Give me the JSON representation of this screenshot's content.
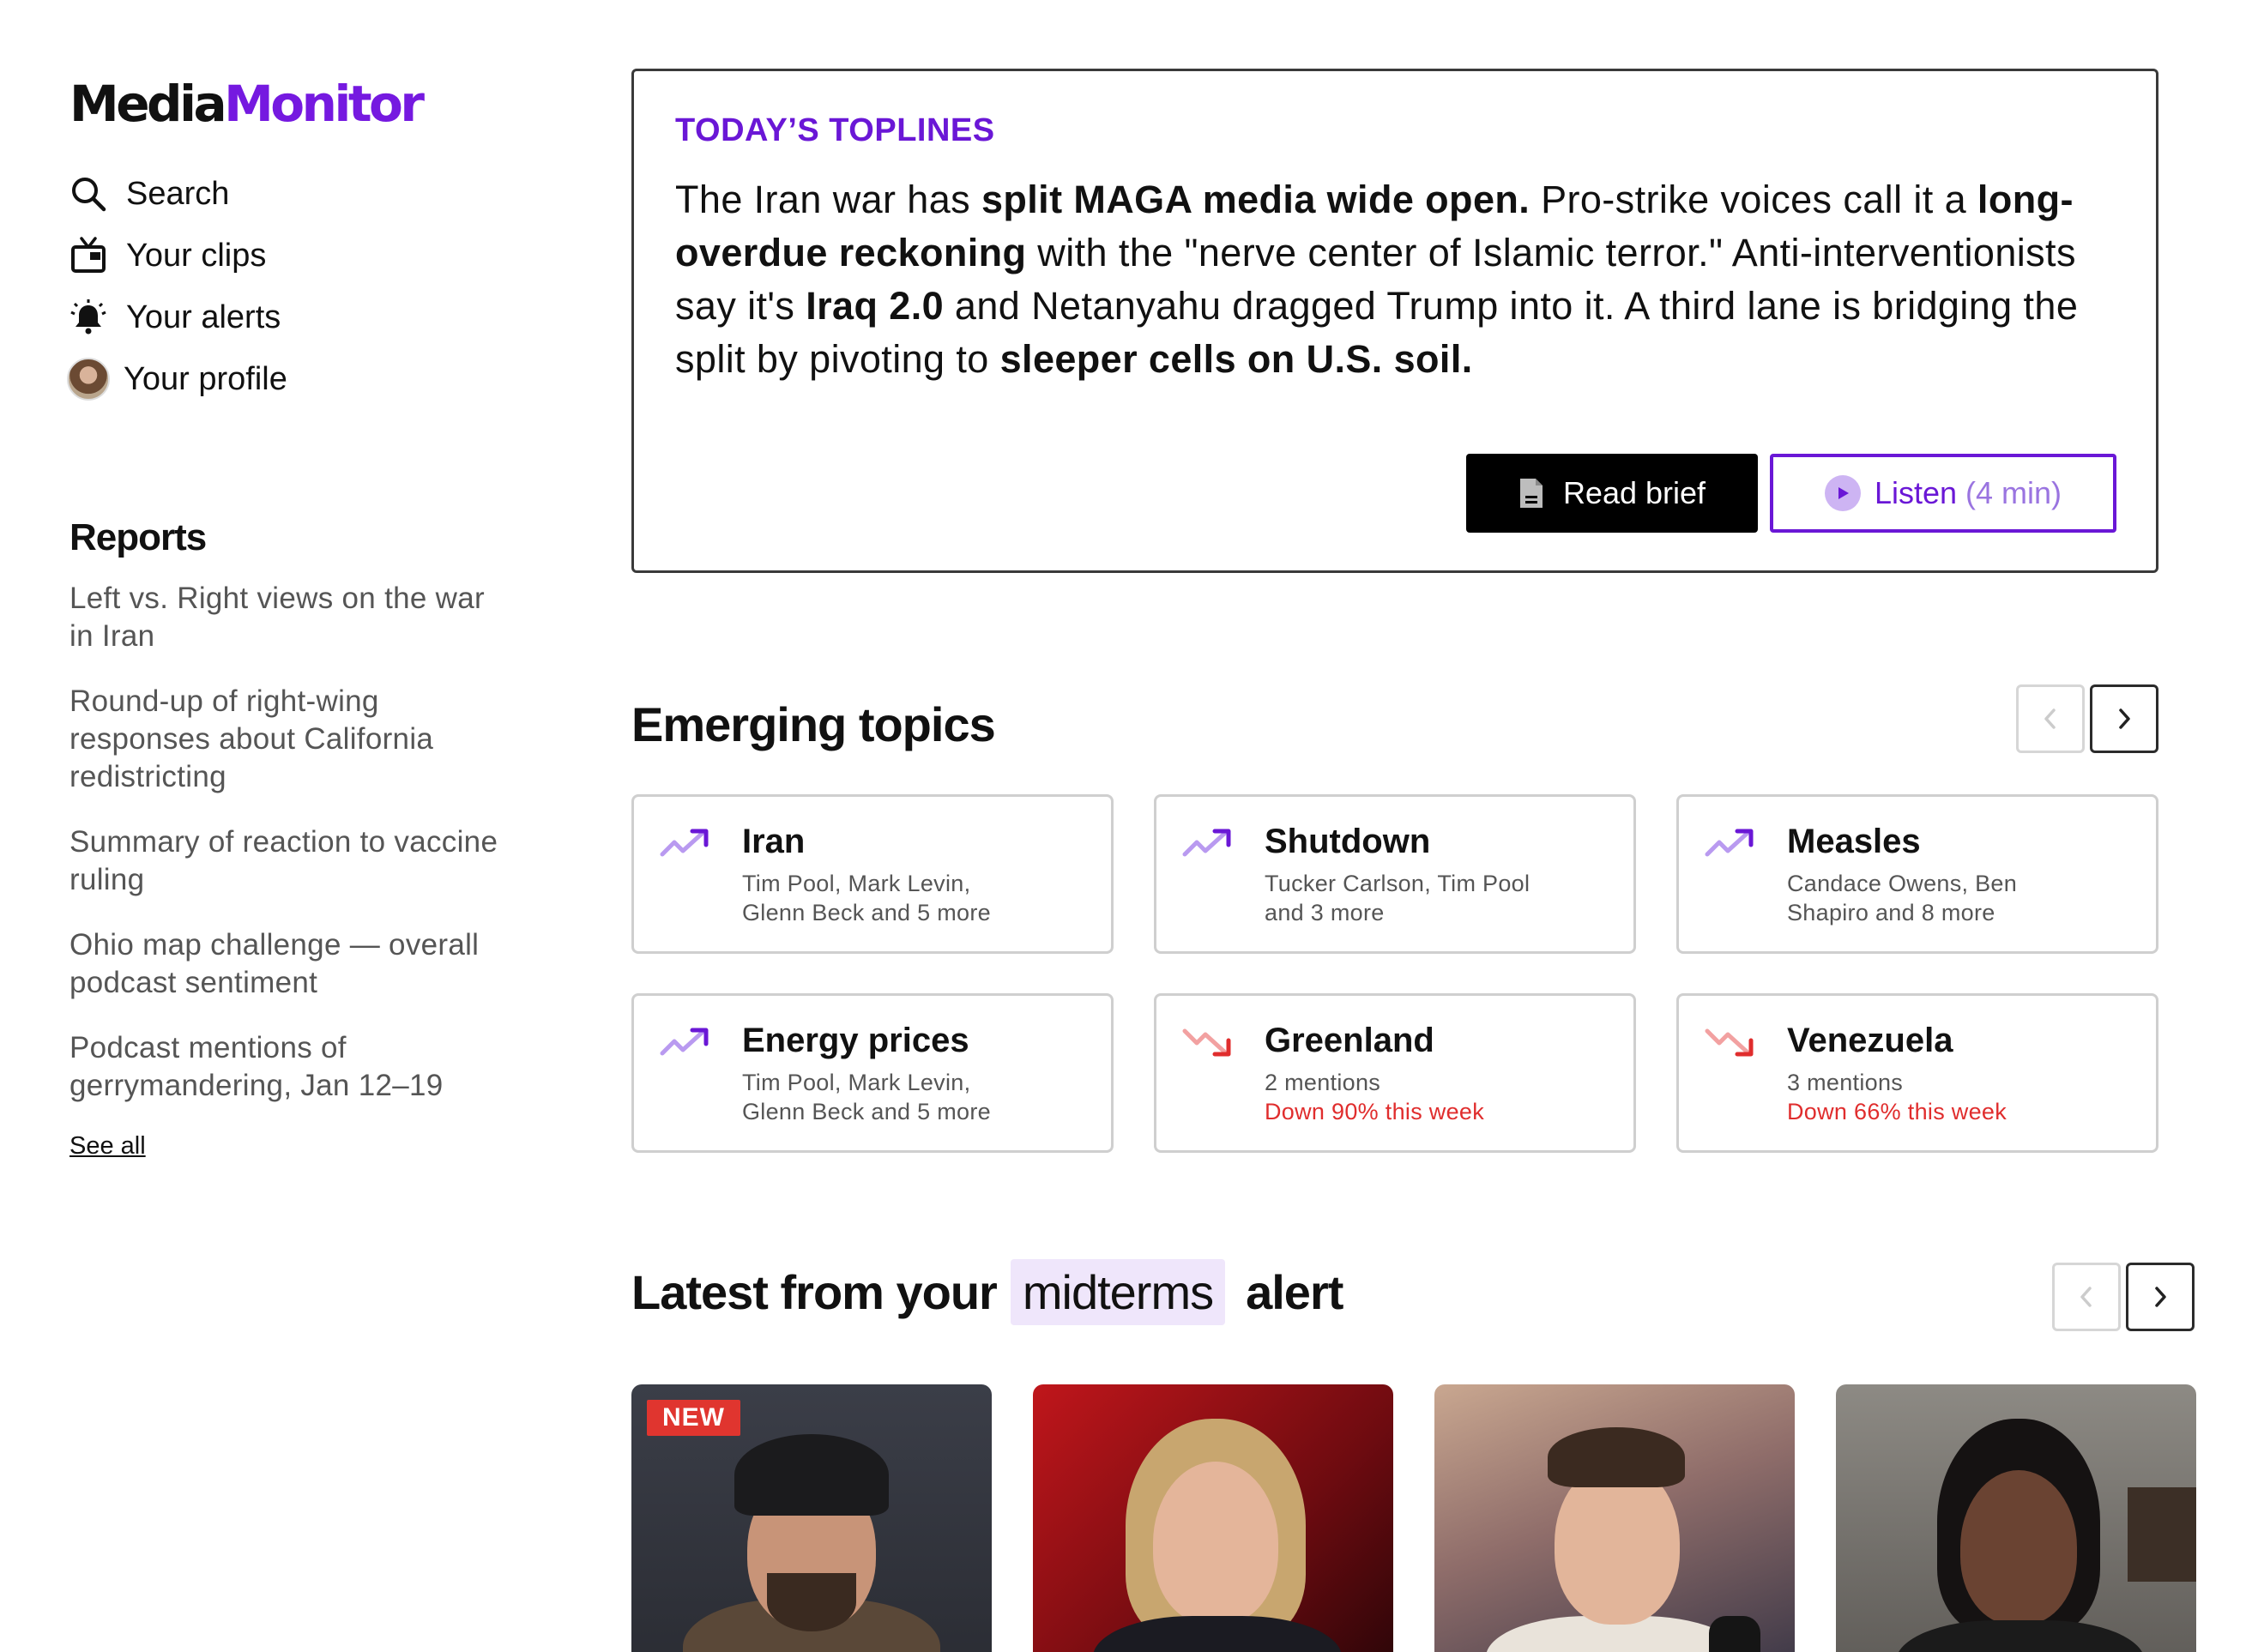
{
  "brand": {
    "part_a": "Media",
    "part_b": "Monitor",
    "accent": "#7519e0"
  },
  "nav": [
    {
      "label": "Search",
      "icon": "search-icon"
    },
    {
      "label": "Your clips",
      "icon": "tv-icon"
    },
    {
      "label": "Your alerts",
      "icon": "bell-icon"
    },
    {
      "label": "Your profile",
      "icon": "avatar"
    }
  ],
  "reports": {
    "title": "Reports",
    "items": [
      "Left vs. Right views on the war in Iran",
      "Round-up of right-wing responses about California redistricting",
      "Summary of reaction to vaccine ruling",
      "Ohio map challenge — overall podcast sentiment",
      "Podcast mentions of gerrymandering, Jan 12–19"
    ],
    "see_all": "See all"
  },
  "toplines": {
    "label": "TODAY’S TOPLINES",
    "segments": [
      "The Iran war has ",
      "split MAGA media wide open.",
      " Pro-strike voices call it a ",
      "long-overdue reckoning",
      " with the \"nerve center of Islamic terror.\" Anti-interventionists say it's ",
      "Iraq 2.0",
      " and Netanyahu dragged Trump into it. A third lane is bridging the split by pivoting to ",
      "sleeper cells on U.S. soil."
    ],
    "read_brief": "Read brief",
    "listen": "Listen",
    "listen_duration": "(4 min)"
  },
  "emerging": {
    "title": "Emerging topics",
    "topics": [
      {
        "name": "Iran",
        "line1": "Tim Pool, Mark Levin,",
        "line2": "Glenn Beck and 5 more",
        "trend": "up"
      },
      {
        "name": "Shutdown",
        "line1": "Tucker Carlson, Tim Pool",
        "line2": "and 3 more",
        "trend": "up"
      },
      {
        "name": "Measles",
        "line1": "Candace Owens, Ben",
        "line2": "Shapiro and 8 more",
        "trend": "up"
      },
      {
        "name": "Energy prices",
        "line1": "Tim Pool, Mark Levin,",
        "line2": "Glenn Beck and 5 more",
        "trend": "up"
      },
      {
        "name": "Greenland",
        "line1": "2 mentions",
        "line2": "Down 90% this week",
        "trend": "down"
      },
      {
        "name": "Venezuela",
        "line1": "3 mentions",
        "line2": "Down 66% this week",
        "trend": "down"
      }
    ]
  },
  "alert": {
    "prefix": "Latest from your",
    "keyword": "midterms",
    "suffix": "alert",
    "new_badge": "NEW"
  },
  "colors": {
    "up": "#7c3aed",
    "down": "#e02d2d",
    "toplines_label": "#6a17d6"
  }
}
